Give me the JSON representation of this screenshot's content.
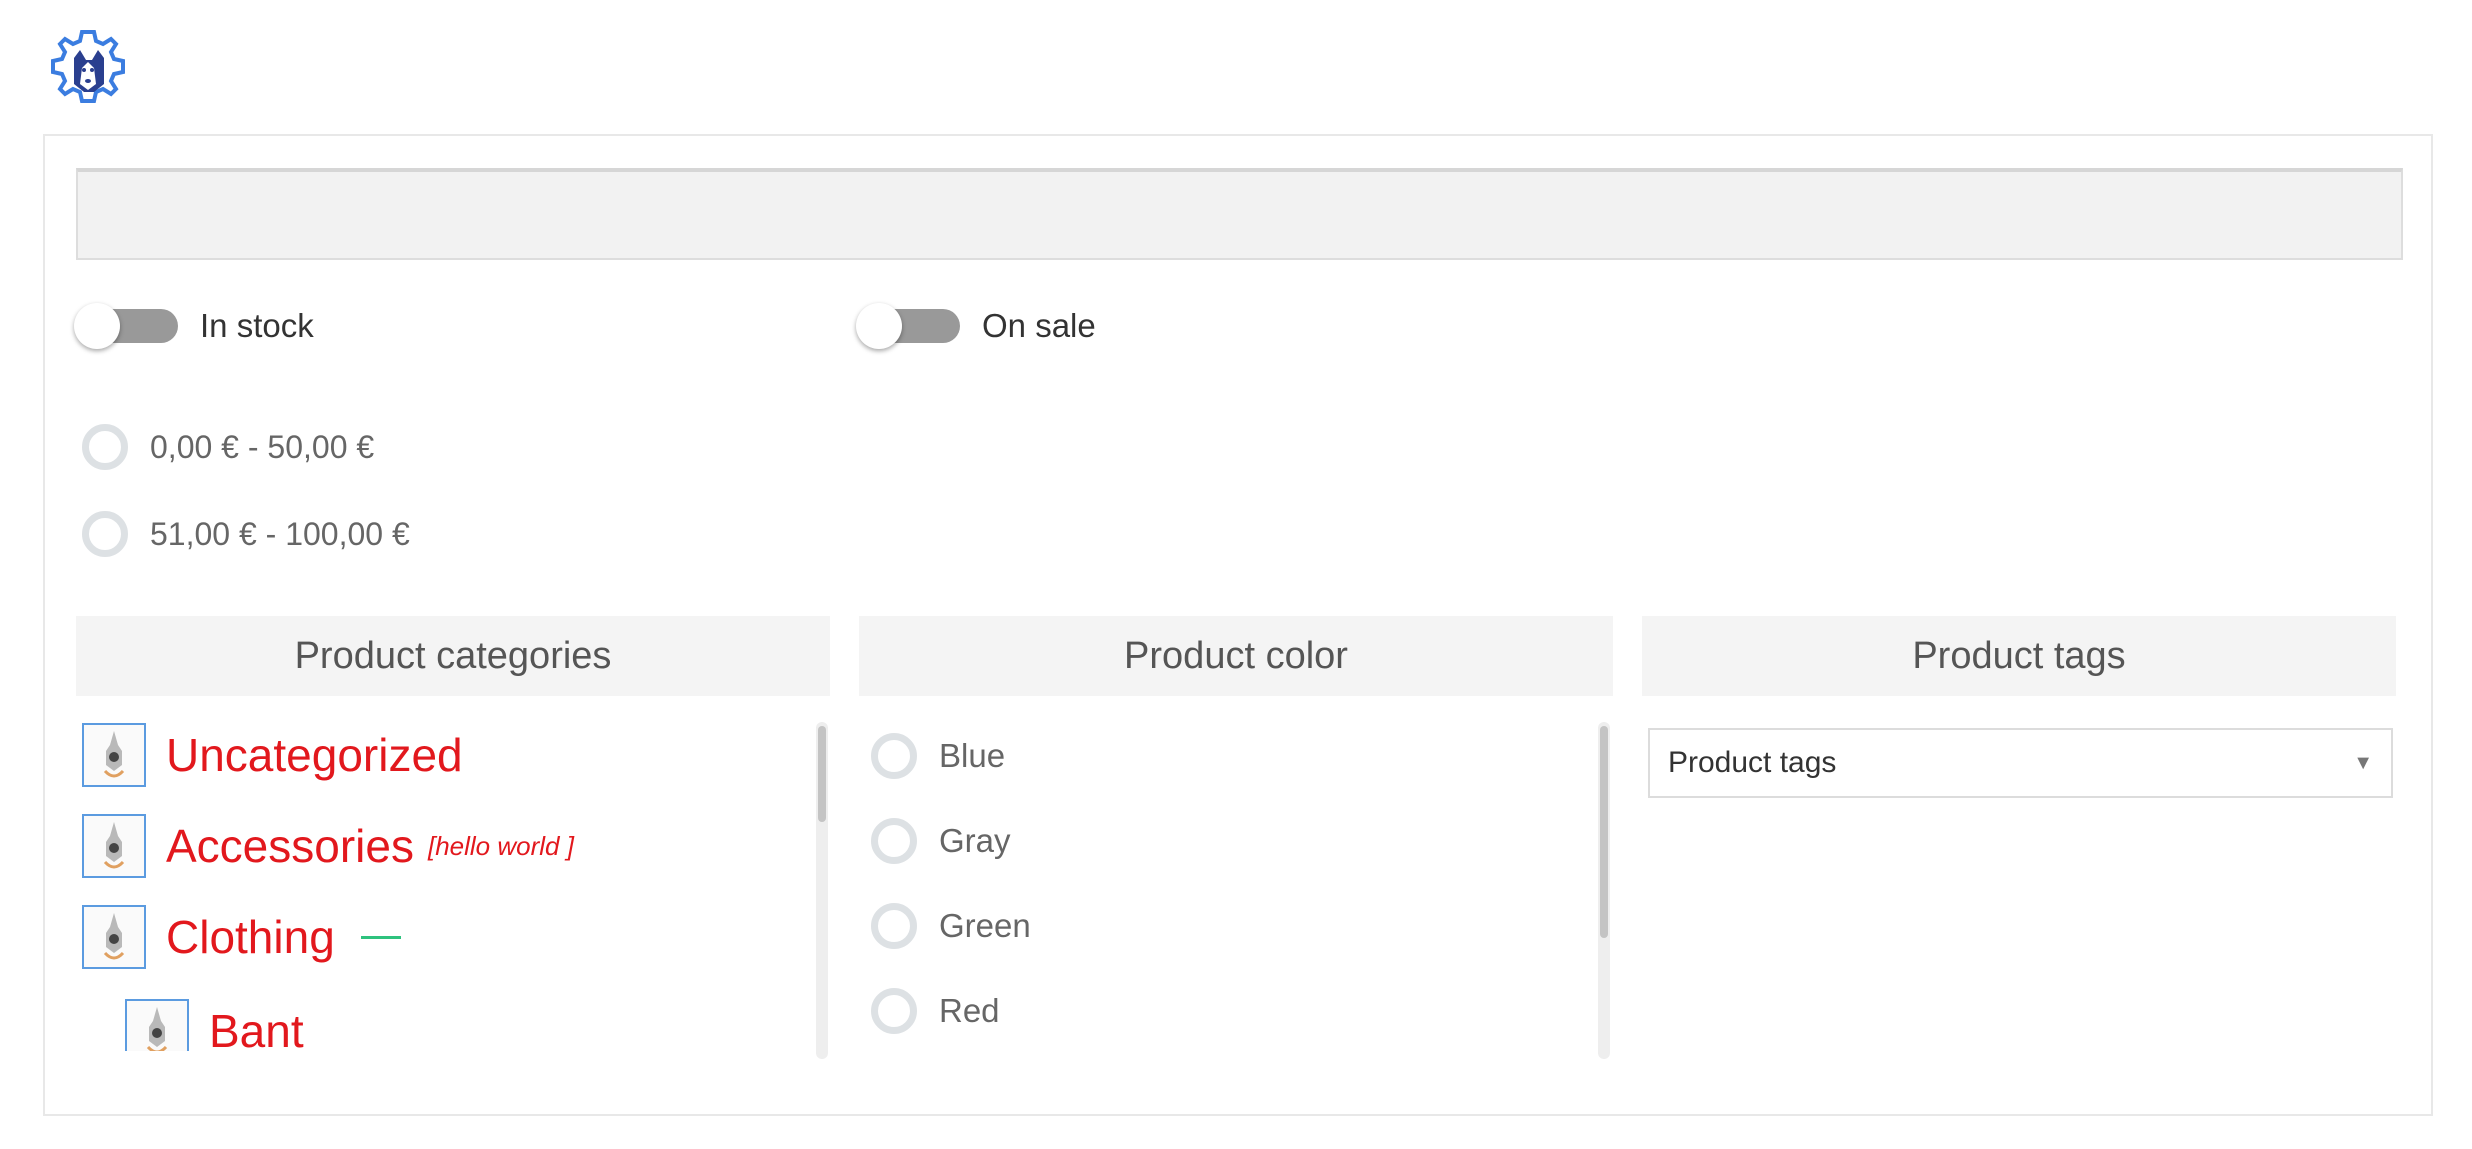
{
  "logo": {
    "icon": "husky-gear-logo-icon",
    "color": "#3b7de0"
  },
  "search": {
    "placeholder": "",
    "value": ""
  },
  "toggles": [
    {
      "label": "In stock",
      "on": false
    },
    {
      "label": "On sale",
      "on": false
    }
  ],
  "price_ranges": [
    {
      "label": "0,00 € - 50,00 €",
      "selected": false
    },
    {
      "label": "51,00 € - 100,00 €",
      "selected": false
    }
  ],
  "columns": {
    "categories": {
      "title": "Product categories",
      "items": [
        {
          "name": "Uncategorized",
          "note": "",
          "icon": "product-thumbnail-icon"
        },
        {
          "name": "Accessories",
          "note": "[hello world ]",
          "icon": "product-thumbnail-icon"
        },
        {
          "name": "Clothing",
          "note": "",
          "expand_icon": "collapse-dash-icon",
          "icon": "product-thumbnail-icon"
        },
        {
          "name": "Bant",
          "note": "",
          "icon": "product-thumbnail-icon"
        }
      ]
    },
    "color": {
      "title": "Product color",
      "options": [
        "Blue",
        "Gray",
        "Green",
        "Red"
      ]
    },
    "tags": {
      "title": "Product tags",
      "select_value": "Product tags",
      "select_icon": "dropdown-arrow-icon"
    }
  },
  "colors": {
    "category_text": "#e2181d",
    "thumbnail_border": "#5b9be0",
    "dash": "#2ec27e",
    "toggle_track": "#999999"
  }
}
